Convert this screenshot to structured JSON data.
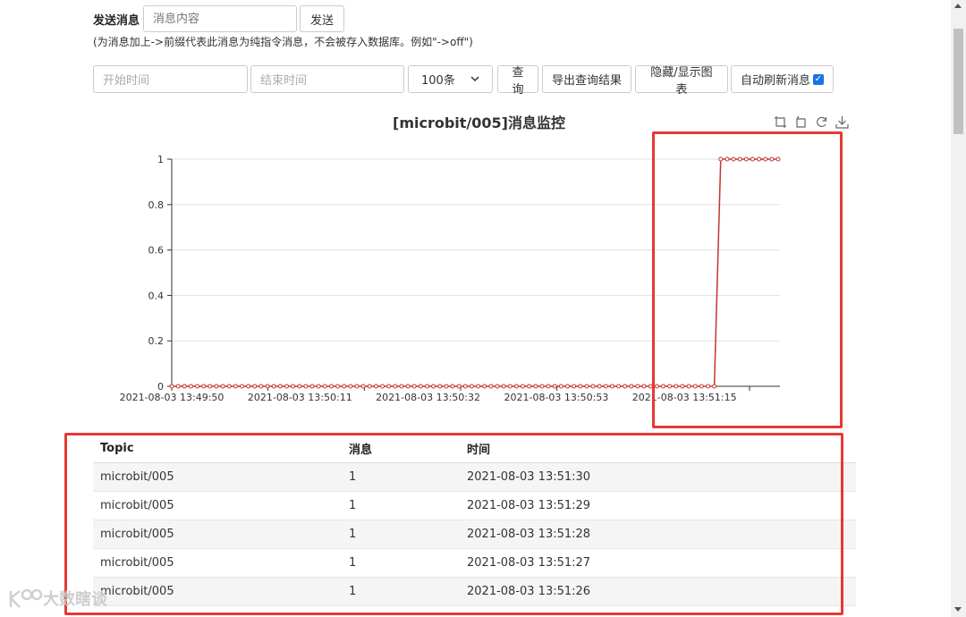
{
  "send": {
    "label": "发送消息",
    "input_placeholder": "消息内容",
    "button": "发送",
    "hint": "(为消息加上->前缀代表此消息为纯指令消息，不会被存入数据库。例如\"->off\")"
  },
  "query": {
    "start_placeholder": "开始时间",
    "end_placeholder": "结束时间",
    "limit_selected": "100条",
    "search_button": "查询",
    "export_button": "导出查询结果",
    "toggle_chart_button": "隐藏/显示图表",
    "auto_refresh_label": "自动刷新消息",
    "auto_refresh_checked": true
  },
  "chart_toolbox": [
    "zoom-icon",
    "zoom-reset-icon",
    "restore-icon",
    "download-icon"
  ],
  "chart_data": {
    "type": "line",
    "title": "[microbit/005]消息监控",
    "x_tick_labels": [
      "2021-08-03 13:49:50",
      "2021-08-03 13:50:11",
      "2021-08-03 13:50:32",
      "2021-08-03 13:50:53",
      "2021-08-03 13:51:15"
    ],
    "ylim": [
      0,
      1
    ],
    "y_ticks": [
      "0",
      "0.2",
      "0.4",
      "0.6",
      "0.8",
      "1"
    ],
    "grid": true,
    "color": "#c23531",
    "series": [
      {
        "values": [
          0,
          0,
          0,
          0,
          0,
          0,
          0,
          0,
          0,
          0,
          0,
          0,
          0,
          0,
          0,
          0,
          0,
          0,
          0,
          0,
          0,
          0,
          0,
          0,
          0,
          0,
          0,
          0,
          0,
          0,
          0,
          0,
          0,
          0,
          0,
          0,
          0,
          0,
          0,
          0,
          0,
          0,
          0,
          0,
          0,
          0,
          0,
          0,
          0,
          0,
          0,
          0,
          0,
          0,
          0,
          0,
          0,
          0,
          0,
          0,
          0,
          0,
          0,
          0,
          0,
          0,
          0,
          0,
          0,
          0,
          0,
          0,
          0,
          0,
          0,
          0,
          0,
          0,
          0,
          0,
          0,
          0,
          0,
          0,
          0,
          0,
          1,
          1,
          1,
          1,
          1,
          1,
          1,
          1,
          1,
          1
        ]
      }
    ]
  },
  "table": {
    "headers": [
      "Topic",
      "消息",
      "时间"
    ],
    "rows": [
      [
        "microbit/005",
        "1",
        "2021-08-03 13:51:30"
      ],
      [
        "microbit/005",
        "1",
        "2021-08-03 13:51:29"
      ],
      [
        "microbit/005",
        "1",
        "2021-08-03 13:51:28"
      ],
      [
        "microbit/005",
        "1",
        "2021-08-03 13:51:27"
      ],
      [
        "microbit/005",
        "1",
        "2021-08-03 13:51:26"
      ]
    ]
  },
  "watermark": "大数瞎谈",
  "colors": {
    "highlight": "#e53935",
    "series": "#c23531",
    "checkbox": "#1a73e8"
  }
}
